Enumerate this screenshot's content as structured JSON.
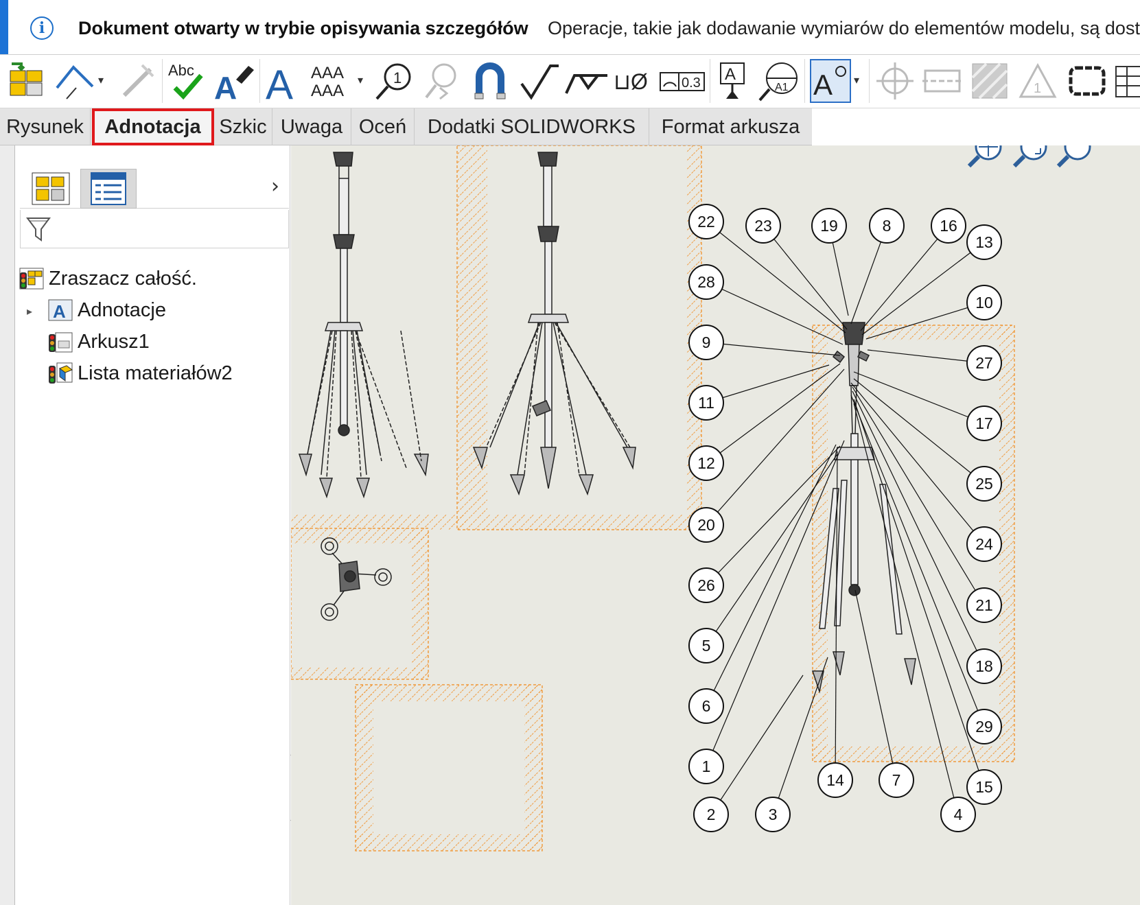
{
  "infobar": {
    "title": "Dokument otwarty w trybie opisywania szczegółów",
    "message": "Operacje, takie jak dodawanie wymiarów do elementów modelu, są doste"
  },
  "toolbar": {
    "note_hint": "Abc",
    "font_sample": "AAA",
    "balloon_label": "1",
    "tolerance_label": "0.3",
    "datum_label": "A1",
    "symbol_label": "⊔Ø"
  },
  "tabs": [
    {
      "label": "Rysunek",
      "active": false
    },
    {
      "label": "Adnotacja",
      "active": true,
      "highlighted": true
    },
    {
      "label": "Szkic",
      "active": false
    },
    {
      "label": "Uwaga",
      "active": false
    },
    {
      "label": "Oceń",
      "active": false
    },
    {
      "label": "Dodatki SOLIDWORKS",
      "active": false
    },
    {
      "label": "Format arkusza",
      "active": false
    }
  ],
  "tree": {
    "root": "Zraszacz całość.",
    "items": [
      "Adnotacje",
      "Arkusz1",
      "Lista materiałów2"
    ]
  },
  "balloons": [
    "22",
    "23",
    "19",
    "8",
    "16",
    "13",
    "28",
    "10",
    "9",
    "27",
    "11",
    "17",
    "12",
    "25",
    "20",
    "24",
    "26",
    "21",
    "5",
    "18",
    "6",
    "29",
    "1",
    "14",
    "7",
    "15",
    "2",
    "3",
    "4"
  ],
  "colors": {
    "accent": "#1d73d6",
    "highlight_red": "#e0191c",
    "hatch_orange": "#f28a1c",
    "canvas_bg": "#e9e9e2"
  },
  "icons": [
    "model-items-icon",
    "smart-dimension-icon",
    "spell-check-icon",
    "format-painter-icon",
    "note-icon",
    "linear-note-pattern-icon",
    "balloon-icon",
    "auto-balloon-icon",
    "magnetic-line-icon",
    "surface-finish-icon",
    "weld-symbol-icon",
    "hole-callout-icon",
    "geometric-tolerance-icon",
    "datum-feature-icon",
    "datum-target-icon",
    "annotation-icon",
    "centermark-icon",
    "centerline-icon",
    "area-hatch-icon",
    "revision-symbol-icon",
    "revision-cloud-icon",
    "table-icon",
    "zoom-to-fit-icon",
    "zoom-area-icon"
  ]
}
